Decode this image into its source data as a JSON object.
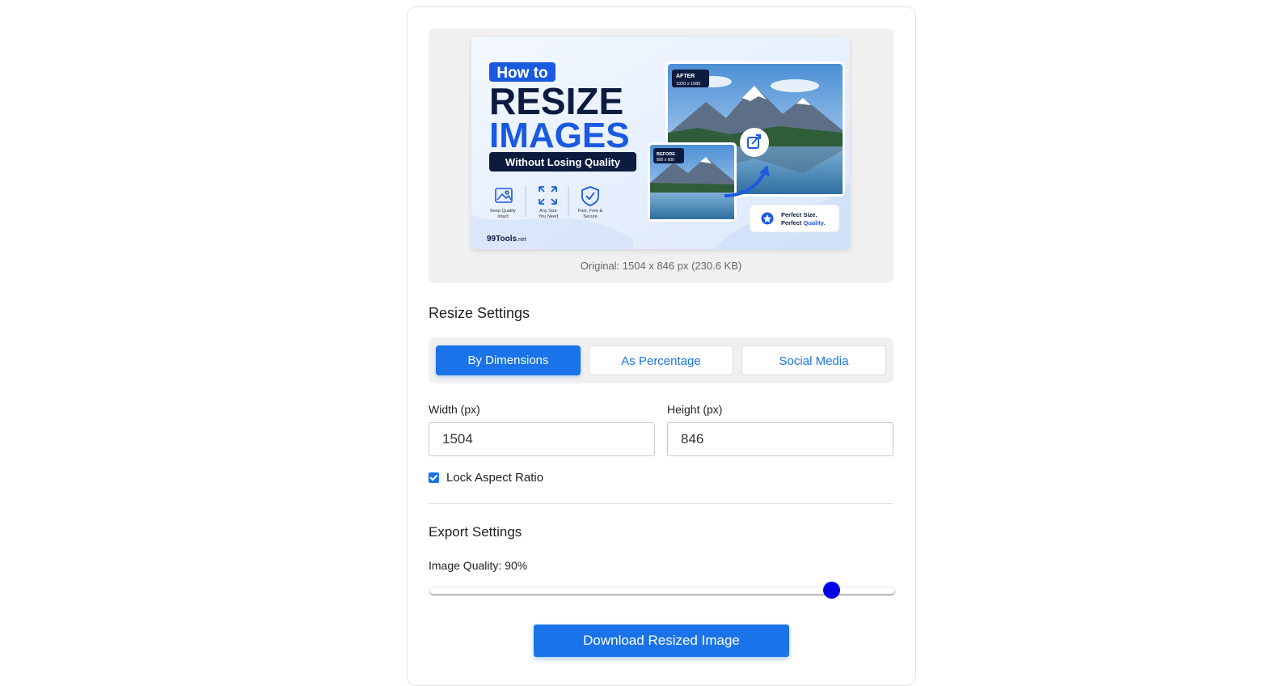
{
  "preview": {
    "original_info": "Original: 1504 x 846 px (230.6 KB)",
    "image": {
      "badge": "How to",
      "title_line1": "RESIZE",
      "title_line2": "IMAGES",
      "subtitle": "Without Losing Quality",
      "features": [
        {
          "line1": "Keep Quality",
          "line2": "Intact",
          "icon": "image-icon"
        },
        {
          "line1": "Any Size",
          "line2": "You Need",
          "icon": "expand-icon"
        },
        {
          "line1": "Fast, Free &",
          "line2": "Secure",
          "icon": "shield-icon"
        }
      ],
      "brand": "99Tools",
      "brand_suffix": ".net",
      "after_label": "AFTER",
      "after_size": "1920 x 1080",
      "before_label": "BEFORE",
      "before_size": "800 x 600",
      "quality_badge_line1": "Perfect Size.",
      "quality_badge_line2a": "Perfect ",
      "quality_badge_line2b": "Quality."
    }
  },
  "resize": {
    "title": "Resize Settings",
    "tabs": [
      {
        "label": "By Dimensions",
        "active": true
      },
      {
        "label": "As Percentage",
        "active": false
      },
      {
        "label": "Social Media",
        "active": false
      }
    ],
    "width_label": "Width (px)",
    "width_value": "1504",
    "height_label": "Height (px)",
    "height_value": "846",
    "lock_label": "Lock Aspect Ratio",
    "lock_checked": true
  },
  "export": {
    "title": "Export Settings",
    "quality_label": "Image Quality: 90%",
    "quality_value": 90,
    "download_label": "Download Resized Image"
  },
  "colors": {
    "accent": "#1a73e8",
    "slider_thumb": "#0000e6"
  }
}
